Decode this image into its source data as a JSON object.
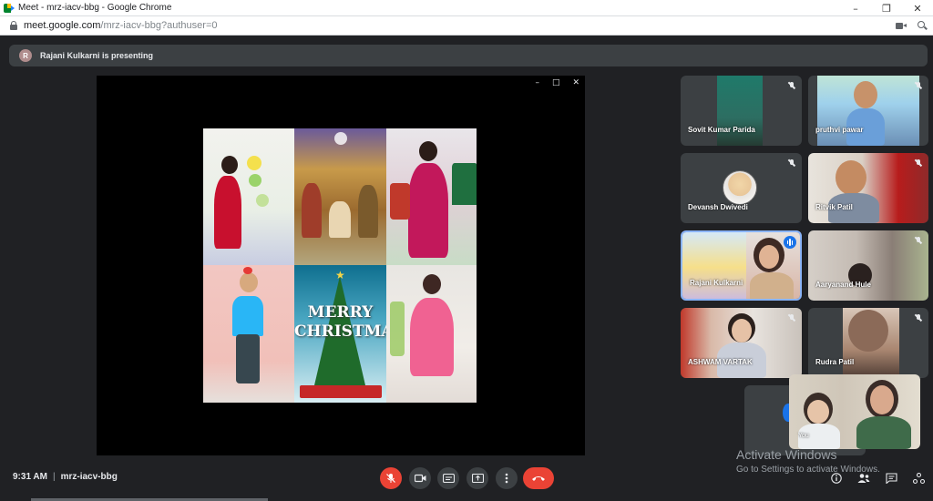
{
  "window": {
    "title": "Meet - mrz-iacv-bbg - Google Chrome",
    "minimize": "–",
    "maximize": "❐",
    "close": "✕"
  },
  "address": {
    "host": "meet.google.com",
    "path": "/mrz-iacv-bbg?authuser=0"
  },
  "banner": {
    "avatar_letter": "R",
    "text": "Rajani Kulkarni is presenting"
  },
  "presentation": {
    "controls": [
      "–",
      "□",
      "✕"
    ],
    "collage_text_1": "MERRY",
    "collage_text_2": "CHRISTMAS"
  },
  "participants": [
    {
      "name": "Sovit Kumar Parida",
      "mic": "muted"
    },
    {
      "name": "pruthvi pawar",
      "mic": "muted"
    },
    {
      "name": "Devansh Dwivedi",
      "mic": "muted"
    },
    {
      "name": "Ritvik Patil",
      "mic": "muted"
    },
    {
      "name": "Rajani Kulkarni",
      "mic": "speaking"
    },
    {
      "name": "Aaryanand Hule",
      "mic": "muted"
    },
    {
      "name": "ASHWAM VARTAK",
      "mic": "muted"
    },
    {
      "name": "Rudra Patil",
      "mic": "muted"
    }
  ],
  "self_view": {
    "name": "You"
  },
  "watermark": {
    "line1": "Activate Windows",
    "line2": "Go to Settings to activate Windows."
  },
  "bottom": {
    "time": "9:31 AM",
    "separator": "|",
    "meeting_code": "mrz-iacv-bbg"
  },
  "colors": {
    "background": "#202124",
    "tile": "#3c4043",
    "danger": "#ea4335",
    "speaking": "#1a73e8"
  }
}
